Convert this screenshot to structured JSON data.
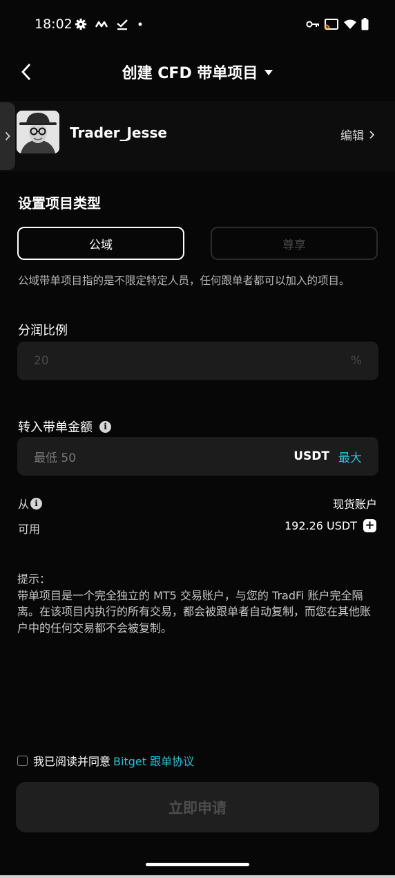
{
  "status_bar": {
    "time": "18:02"
  },
  "header": {
    "title": "创建 CFD 带单项目"
  },
  "profile": {
    "username": "Trader_Jesse",
    "edit_label": "编辑"
  },
  "project_type": {
    "title": "设置项目类型",
    "options": [
      {
        "label": "公域",
        "selected": true
      },
      {
        "label": "尊享",
        "selected": false
      }
    ],
    "description": "公域带单项目指的是不限定特定人员，任何跟单者都可以加入的项目。"
  },
  "profit_share": {
    "label": "分润比例",
    "placeholder": "20",
    "unit": "%"
  },
  "transfer": {
    "label": "转入带单金额",
    "placeholder": "最低 50",
    "currency": "USDT",
    "max_label": "最大",
    "from_label": "从",
    "from_value": "现货账户",
    "available_label": "可用",
    "available_value": "192.26 USDT"
  },
  "tips": {
    "title": "提示：",
    "body": "带单项目是一个完全独立的 MT5 交易账户，与您的 TradFi 账户完全隔离。在该项目内执行的所有交易，都会被跟单者自动复制，而您在其他账户中的任何交易都不会被复制。"
  },
  "agreement": {
    "text": "我已阅读并同意",
    "link": "Bitget 跟单协议",
    "checked": false
  },
  "submit": {
    "label": "立即申请"
  },
  "colors": {
    "accent": "#27c2d3",
    "background": "#070707",
    "field": "#1c1c1c"
  }
}
